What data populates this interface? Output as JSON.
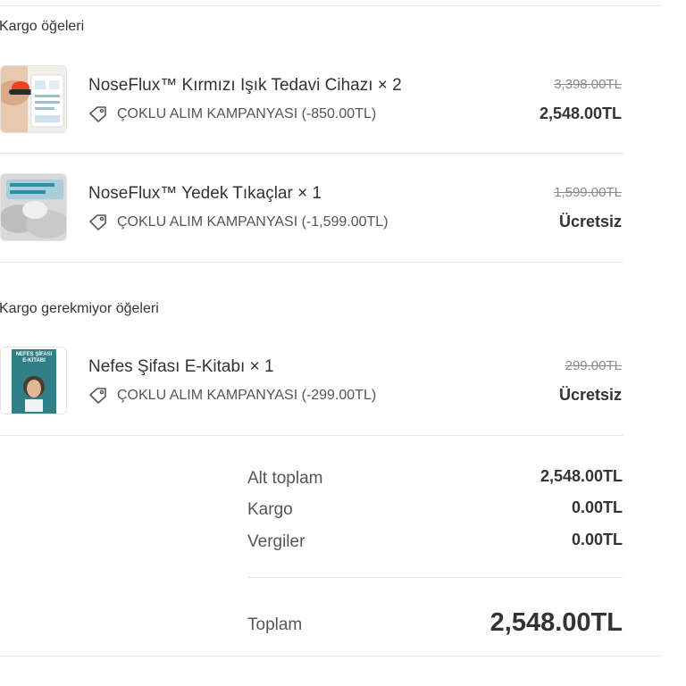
{
  "sections": {
    "shipping_title": "Kargo öğeleri",
    "no_shipping_title": "Kargo gerekmiyor öğeleri"
  },
  "items": [
    {
      "name": "NoseFlux™ Kırmızı Işık Tedavi Cihazı × 2",
      "promo": "ÇOKLU ALIM KAMPANYASI (-850.00TL)",
      "old_price": "3,398.00TL",
      "price": "2,548.00TL"
    },
    {
      "name": "NoseFlux™ Yedek Tıkaçlar × 1",
      "promo": "ÇOKLU ALIM KAMPANYASI (-1,599.00TL)",
      "old_price": "1,599.00TL",
      "price": "Ücretsiz"
    },
    {
      "name": "Nefes Şifası E-Kitabı × 1",
      "promo": "ÇOKLU ALIM KAMPANYASI (-299.00TL)",
      "old_price": "299.00TL",
      "price": "Ücretsiz",
      "thumb_title": "NEFES ŞİFASI",
      "thumb_subtitle": "E-KİTABI"
    }
  ],
  "totals": {
    "subtotal_label": "Alt toplam",
    "subtotal_value": "2,548.00TL",
    "shipping_label": "Kargo",
    "shipping_value": "0.00TL",
    "tax_label": "Vergiler",
    "tax_value": "0.00TL",
    "total_label": "Toplam",
    "total_value": "2,548.00TL"
  },
  "icons": {
    "promo": "tag-icon"
  },
  "colors": {
    "text": "#333333",
    "muted": "#8a8a8a",
    "divider": "#e6e6e6"
  }
}
